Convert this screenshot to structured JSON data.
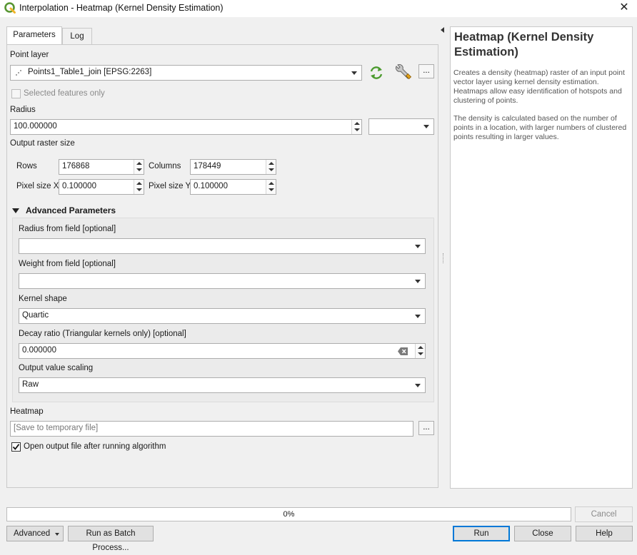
{
  "window": {
    "title": "Interpolation - Heatmap (Kernel Density Estimation)",
    "close_glyph": "✕"
  },
  "tabs": [
    {
      "label": "Parameters"
    },
    {
      "label": "Log"
    }
  ],
  "form": {
    "point_layer_label": "Point layer",
    "point_layer_value": "Points1_Table1_join [EPSG:2263]",
    "selected_features_only": "Selected features only",
    "radius_label": "Radius",
    "radius_value": "100.000000",
    "output_raster_size_label": "Output raster size",
    "rows_label": "Rows",
    "rows_value": "176868",
    "columns_label": "Columns",
    "columns_value": "178449",
    "pixel_size_x_label": "Pixel size X",
    "pixel_size_x_value": "0.100000",
    "pixel_size_y_label": "Pixel size Y",
    "pixel_size_y_value": "0.100000",
    "ellipsis": "..."
  },
  "advanced": {
    "header": "Advanced Parameters",
    "radius_field_label": "Radius from field [optional]",
    "weight_field_label": "Weight from field [optional]",
    "kernel_shape_label": "Kernel shape",
    "kernel_shape_value": "Quartic",
    "decay_ratio_label": "Decay ratio (Triangular kernels only) [optional]",
    "decay_ratio_value": "0.000000",
    "output_scaling_label": "Output value scaling",
    "output_scaling_value": "Raw"
  },
  "output": {
    "heatmap_label": "Heatmap",
    "heatmap_placeholder": "[Save to temporary file]",
    "open_after_label": "Open output file after running algorithm",
    "open_after_checked": true
  },
  "help": {
    "title": "Heatmap (Kernel Density Estimation)",
    "para1": "Creates a density (heatmap) raster of an input point vector layer using kernel density estimation. Heatmaps allow easy identification of hotspots and clustering of points.",
    "para2": "The density is calculated based on the number of points in a location, with larger numbers of clustered points resulting in larger values."
  },
  "progress": {
    "value": 0,
    "label": "0%"
  },
  "buttons": {
    "cancel": "Cancel",
    "advanced": "Advanced",
    "batch": "Run as Batch Process...",
    "run": "Run",
    "close": "Close",
    "help": "Help"
  },
  "colors": {
    "qgis_green": "#589632",
    "qgis_yellow": "#f0b429",
    "accent_blue": "#0078d7"
  }
}
